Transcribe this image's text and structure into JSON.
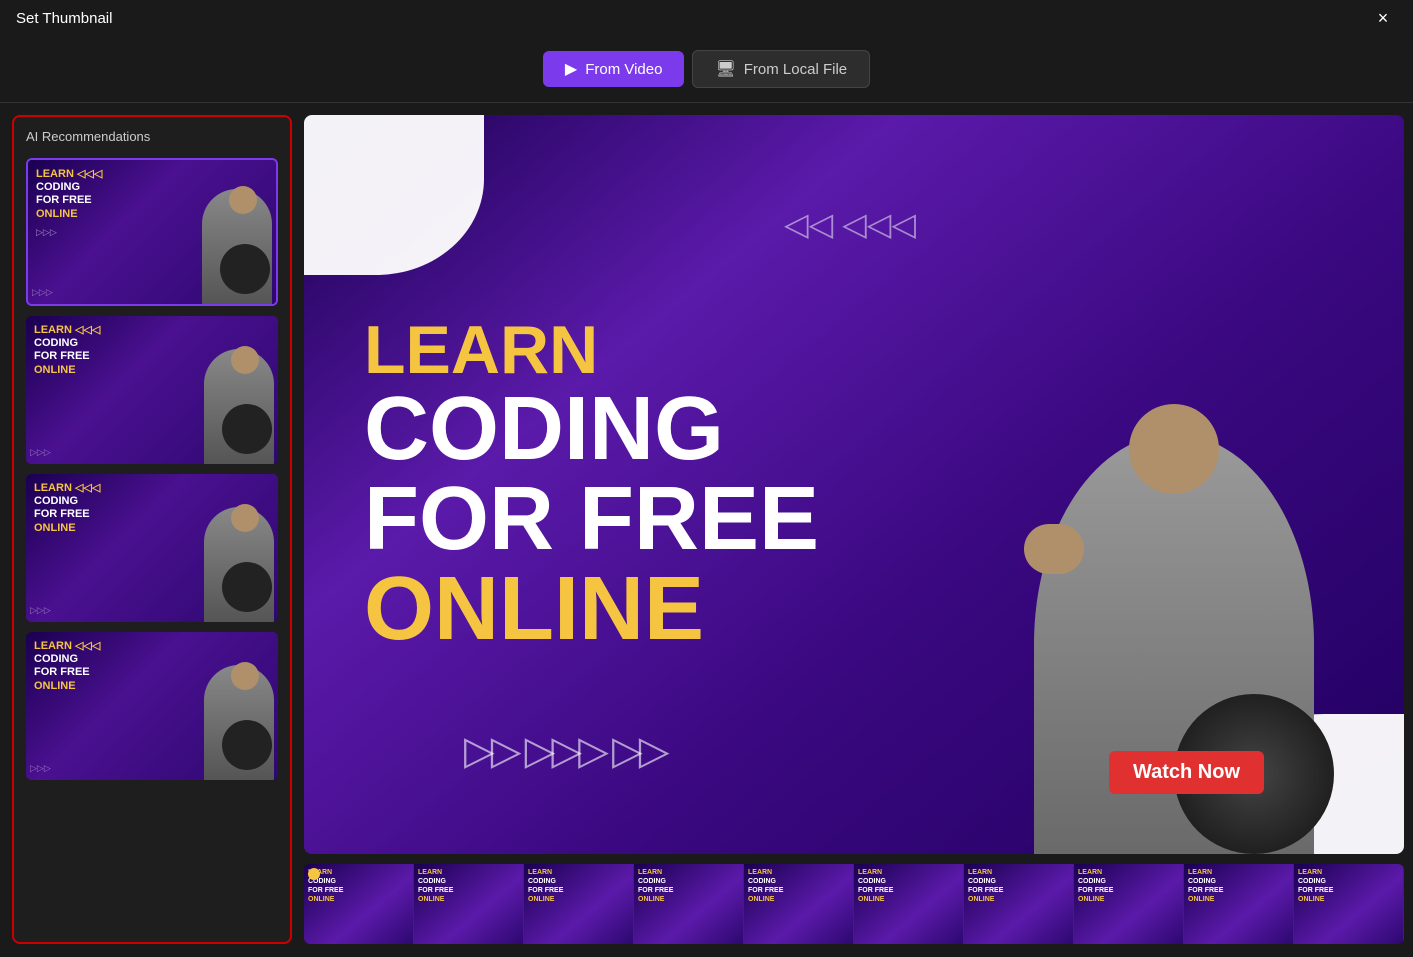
{
  "titleBar": {
    "title": "Set Thumbnail",
    "closeLabel": "×"
  },
  "tabs": [
    {
      "id": "from-video",
      "label": "From Video",
      "icon": "▶",
      "active": true
    },
    {
      "id": "from-local-file",
      "label": "From Local File",
      "icon": "📁",
      "active": false
    }
  ],
  "sidebar": {
    "title": "AI Recommendations",
    "thumbnails": [
      {
        "id": 1,
        "selected": true,
        "text": "LEARN CODING FOR FREE ONLINE"
      },
      {
        "id": 2,
        "selected": false,
        "text": "LEARN CODING FOR FREE ONLINE"
      },
      {
        "id": 3,
        "selected": false,
        "text": "LEARN CODING FOR FREE ONLINE"
      },
      {
        "id": 4,
        "selected": false,
        "text": "LEARN CODING FOR FREE ONLINE"
      }
    ]
  },
  "mainPreview": {
    "lines": {
      "learn": "LEARN",
      "coding": "CODING",
      "forFree": "FOR FREE",
      "online": "ONLINE"
    },
    "watchNow": "Watch Now"
  },
  "filmstrip": {
    "thumbCount": 10,
    "text": {
      "learn": "LEARN",
      "coding": "CODING",
      "forFree": "FOR FREE",
      "online": "ONLINE"
    }
  }
}
